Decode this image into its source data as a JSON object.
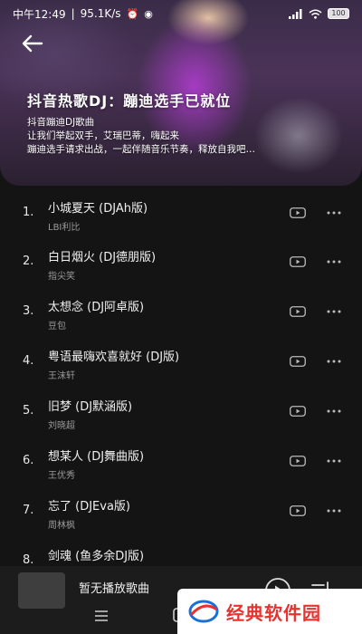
{
  "status_bar": {
    "time": "中午12:49",
    "speed": "95.1K/s",
    "battery": "100"
  },
  "header": {
    "title": "抖音热歌DJ：蹦迪选手已就位",
    "description": [
      "抖音蹦迪DJ歌曲",
      "让我们举起双手，艾瑞巴蒂，嗨起来",
      "蹦迪选手请求出战，一起伴随音乐节奏，释放自我吧…"
    ]
  },
  "songs": [
    {
      "num": "1.",
      "title": "小城夏天 (DJAh版)",
      "artist": "LBI利比"
    },
    {
      "num": "2.",
      "title": "白日烟火 (DJ德朋版)",
      "artist": "指尖笑"
    },
    {
      "num": "3.",
      "title": "太想念 (DJ阿卓版)",
      "artist": "豆包"
    },
    {
      "num": "4.",
      "title": "粤语最嗨欢喜就好 (DJ版)",
      "artist": "王沫轩"
    },
    {
      "num": "5.",
      "title": "旧梦 (DJ默涵版)",
      "artist": "刘晓超"
    },
    {
      "num": "6.",
      "title": "想某人 (DJ舞曲版)",
      "artist": "王优秀"
    },
    {
      "num": "7.",
      "title": "忘了 (DJEva版)",
      "artist": "周林枫"
    },
    {
      "num": "8.",
      "title": "剑魂 (鱼多余DJ版)",
      "artist": ""
    }
  ],
  "player": {
    "now_playing": "暂无播放歌曲"
  },
  "watermark": {
    "text": "经典软件园"
  }
}
